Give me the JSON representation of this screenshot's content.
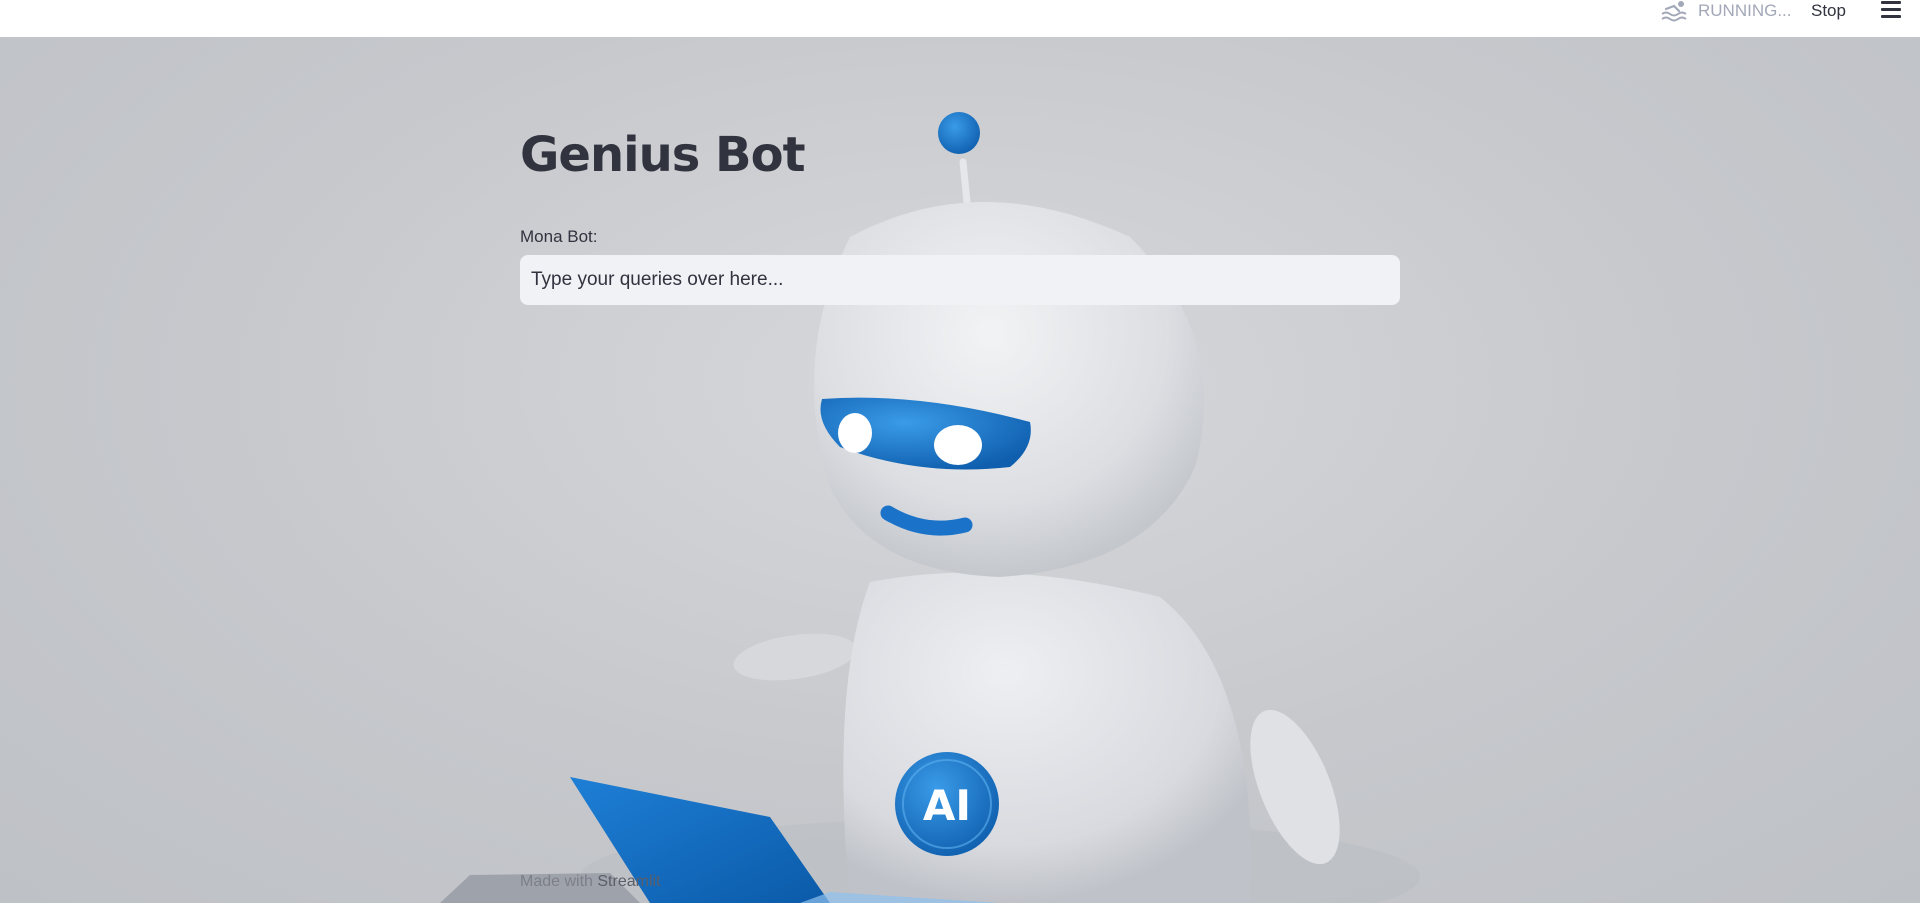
{
  "header": {
    "status_text": "RUNNING...",
    "stop_label": "Stop",
    "status_icon": "swimmer-icon",
    "menu_icon": "hamburger-menu-icon"
  },
  "main": {
    "title": "Genius Bot",
    "input_label": "Mona Bot:",
    "input_placeholder": "Type your queries over here...",
    "input_value": ""
  },
  "background": {
    "image": "robot-illustration",
    "chest_badge": "AI",
    "accent_color": "#1a73c8",
    "body_color": "#e4e6e9"
  },
  "footer": {
    "prefix": "Made with",
    "brand": "Streamlit"
  }
}
